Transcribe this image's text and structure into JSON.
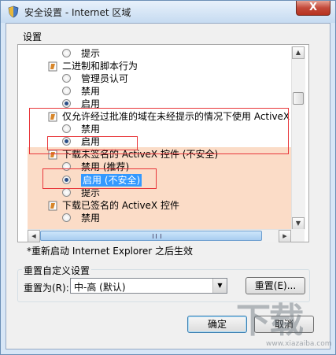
{
  "window": {
    "title": "安全设置 - Internet 区域",
    "close_label": "X"
  },
  "settings": {
    "group_label": "设置",
    "items": [
      {
        "type": "option",
        "label": "提示",
        "checked": false
      },
      {
        "type": "header",
        "label": "二进制和脚本行为"
      },
      {
        "type": "option",
        "label": "管理员认可",
        "checked": false
      },
      {
        "type": "option",
        "label": "禁用",
        "checked": false
      },
      {
        "type": "option",
        "label": "启用",
        "checked": true
      },
      {
        "type": "header",
        "label": "仅允许经过批准的域在未经提示的情况下使用 ActiveX"
      },
      {
        "type": "option",
        "label": "禁用",
        "checked": false
      },
      {
        "type": "option",
        "label": "启用",
        "checked": true
      },
      {
        "type": "header",
        "label": "下载未签名的 ActiveX 控件 (不安全)"
      },
      {
        "type": "option",
        "label": "禁用 (推荐)",
        "checked": false
      },
      {
        "type": "option",
        "label": "启用 (不安全)",
        "checked": true,
        "selected": true
      },
      {
        "type": "option",
        "label": "提示",
        "checked": false
      },
      {
        "type": "header",
        "label": "下载已签名的 ActiveX 控件"
      },
      {
        "type": "option",
        "label": "禁用",
        "checked": false
      }
    ]
  },
  "note": "*重新启动 Internet Explorer 之后生效",
  "reset": {
    "group_label": "重置自定义设置",
    "label": "重置为(R):",
    "selected_value": "中-高 (默认)",
    "button_label": "重置(E)..."
  },
  "buttons": {
    "ok": "确定",
    "cancel": "取消"
  },
  "watermark": {
    "main": "下载",
    "sub": "www.xiazaiba.com"
  },
  "colors": {
    "highlight_band": "#fbdcc7",
    "selection": "#3399ff",
    "annotation_red": "#e8363a"
  }
}
